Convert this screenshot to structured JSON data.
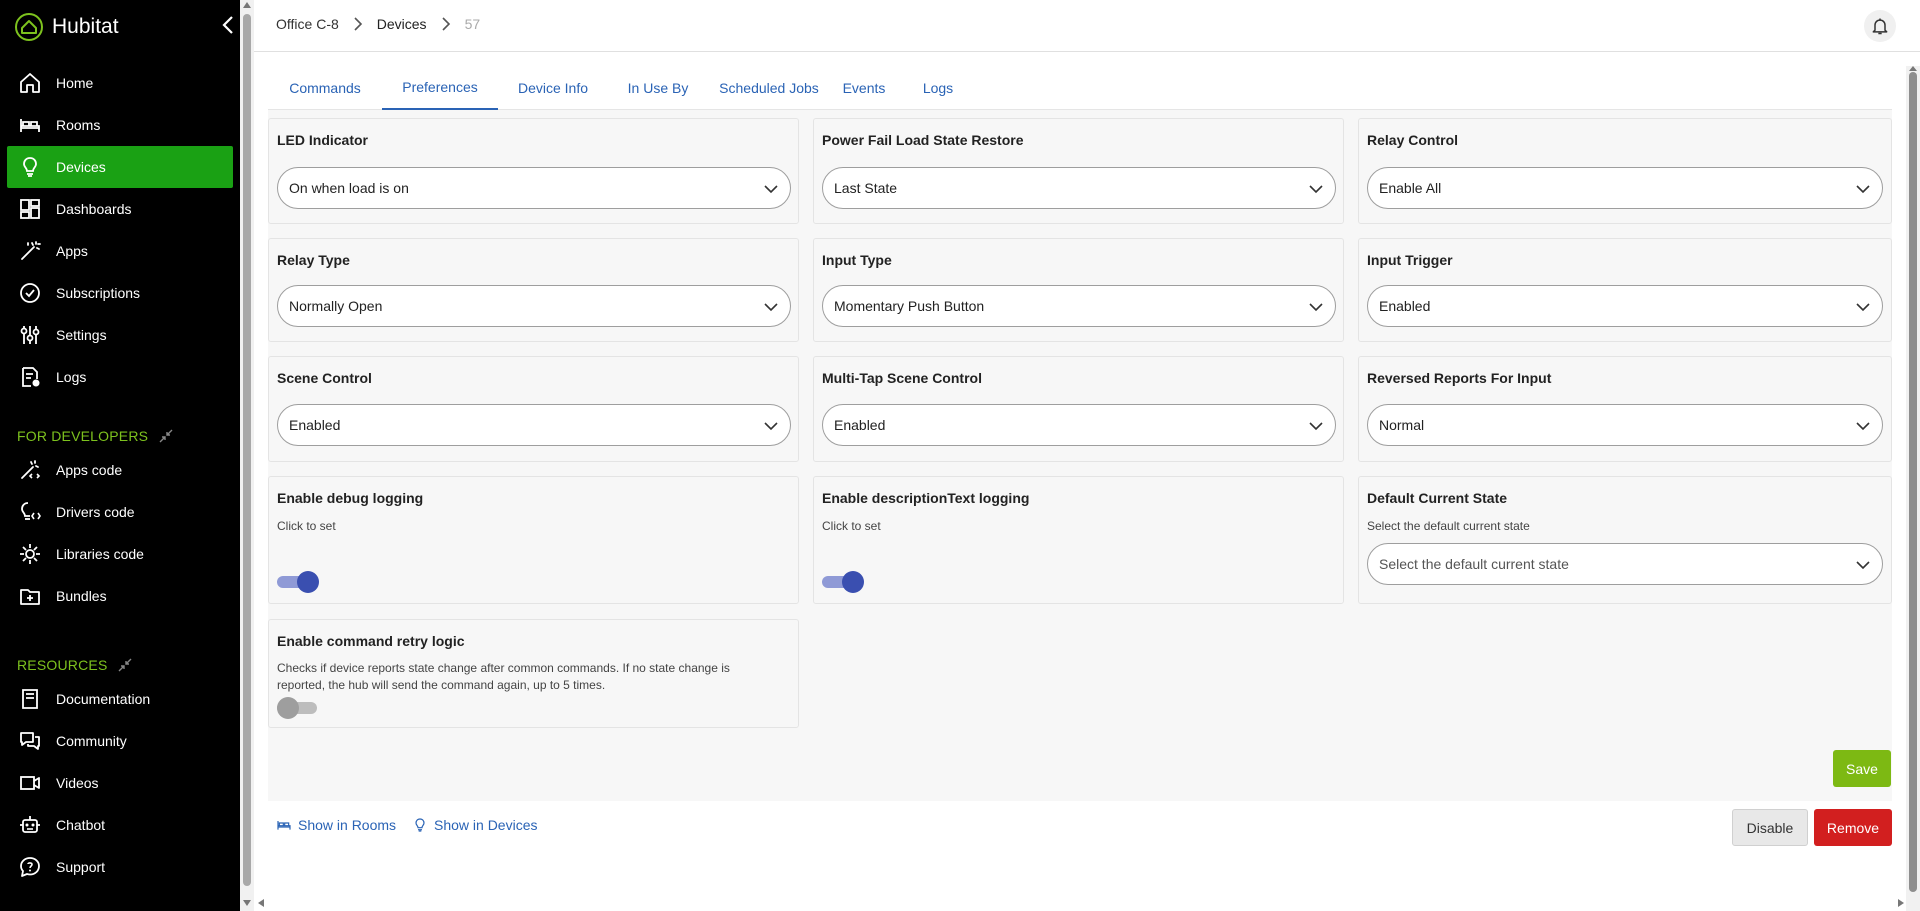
{
  "app": {
    "name": "Hubitat",
    "accent": "#1aa114",
    "section_color": "#7dc21e"
  },
  "sidebar": {
    "items": [
      {
        "label": "Home",
        "icon": "home-icon"
      },
      {
        "label": "Rooms",
        "icon": "bed-icon"
      },
      {
        "label": "Devices",
        "icon": "lightbulb-icon",
        "active": true
      },
      {
        "label": "Dashboards",
        "icon": "dashboard-icon"
      },
      {
        "label": "Apps",
        "icon": "magic-wand-icon"
      },
      {
        "label": "Subscriptions",
        "icon": "check-circle-icon"
      },
      {
        "label": "Settings",
        "icon": "sliders-icon"
      },
      {
        "label": "Logs",
        "icon": "log-file-icon"
      }
    ],
    "developers": {
      "title": "FOR DEVELOPERS",
      "items": [
        {
          "label": "Apps code",
          "icon": "apps-code-icon"
        },
        {
          "label": "Drivers code",
          "icon": "drivers-code-icon"
        },
        {
          "label": "Libraries code",
          "icon": "libraries-code-icon"
        },
        {
          "label": "Bundles",
          "icon": "bundle-icon"
        }
      ]
    },
    "resources": {
      "title": "RESOURCES",
      "items": [
        {
          "label": "Documentation",
          "icon": "book-icon"
        },
        {
          "label": "Community",
          "icon": "chat-bubbles-icon"
        },
        {
          "label": "Videos",
          "icon": "video-icon"
        },
        {
          "label": "Chatbot",
          "icon": "robot-icon"
        },
        {
          "label": "Support",
          "icon": "help-bubble-icon"
        }
      ]
    }
  },
  "breadcrumb": {
    "hub": "Office C-8",
    "section": "Devices",
    "device_id": "57"
  },
  "tabs": [
    {
      "label": "Commands"
    },
    {
      "label": "Preferences",
      "active": true
    },
    {
      "label": "Device Info"
    },
    {
      "label": "In Use By"
    },
    {
      "label": "Scheduled Jobs"
    },
    {
      "label": "Events"
    },
    {
      "label": "Logs"
    }
  ],
  "preferences": {
    "led_indicator": {
      "title": "LED Indicator",
      "value": "On when load is on"
    },
    "power_fail": {
      "title": "Power Fail Load State Restore",
      "value": "Last State"
    },
    "relay_control": {
      "title": "Relay Control",
      "value": "Enable All"
    },
    "relay_type": {
      "title": "Relay Type",
      "value": "Normally Open"
    },
    "input_type": {
      "title": "Input Type",
      "value": "Momentary Push Button"
    },
    "input_trigger": {
      "title": "Input Trigger",
      "value": "Enabled"
    },
    "scene_control": {
      "title": "Scene Control",
      "value": "Enabled"
    },
    "multitap_scene": {
      "title": "Multi-Tap Scene Control",
      "value": "Enabled"
    },
    "reversed_reports": {
      "title": "Reversed Reports For Input",
      "value": "Normal"
    },
    "debug_logging": {
      "title": "Enable debug logging",
      "hint": "Click to set",
      "enabled": true
    },
    "desc_logging": {
      "title": "Enable descriptionText logging",
      "hint": "Click to set",
      "enabled": true
    },
    "default_state": {
      "title": "Default Current State",
      "hint": "Select the default current state",
      "placeholder": "Select the default current state"
    },
    "retry_logic": {
      "title": "Enable command retry logic",
      "hint_line1": "Checks if device reports state change after common commands. If no state change is",
      "hint_line2": "reported, the hub will send the command again, up to 5 times.",
      "enabled": false
    }
  },
  "actions": {
    "save": "Save",
    "show_in_rooms": "Show in Rooms",
    "show_in_devices": "Show in Devices",
    "disable": "Disable",
    "remove": "Remove"
  }
}
